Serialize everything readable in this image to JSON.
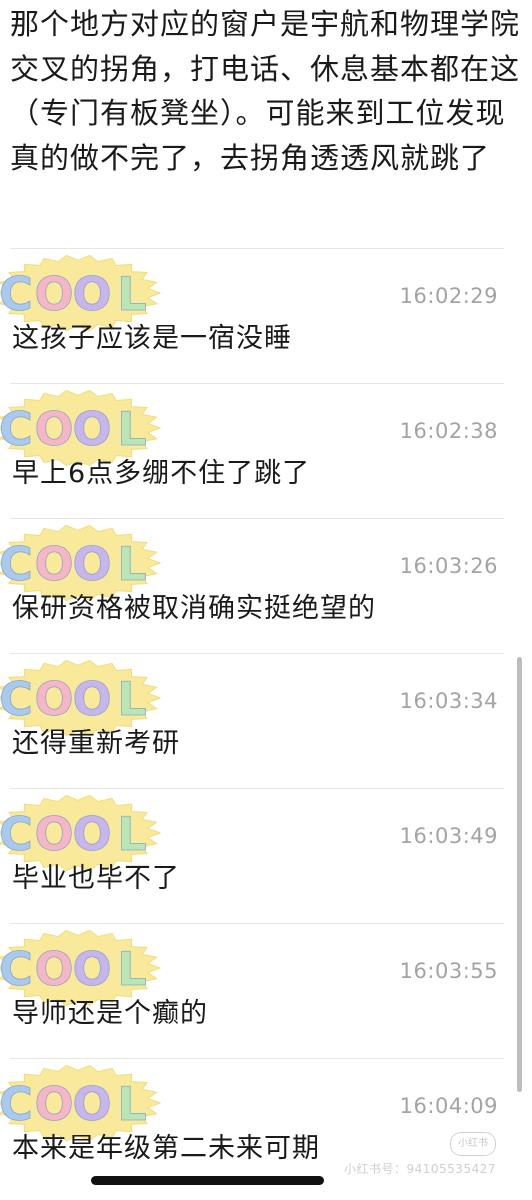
{
  "intro_text": "那个地方对应的窗户是宇航和物理学院交叉的拐角，打电话、休息基本都在这（专门有板凳坐）。可能来到工位发现真的做不完了，去拐角透透风就跳了",
  "avatar": {
    "label": "COOL",
    "blob_color": "#f8ea9a",
    "letter_colors": [
      "#a9c9f0",
      "#f6b6c8",
      "#c9b5ee",
      "#b9e6b4"
    ]
  },
  "messages": [
    {
      "time": "16:02:29",
      "text": "这孩子应该是一宿没睡"
    },
    {
      "time": "16:02:38",
      "text": "早上6点多绷不住了跳了"
    },
    {
      "time": "16:03:26",
      "text": "保研资格被取消确实挺绝望的"
    },
    {
      "time": "16:03:34",
      "text": "还得重新考研"
    },
    {
      "time": "16:03:49",
      "text": "毕业也毕不了"
    },
    {
      "time": "16:03:55",
      "text": "导师还是个癫的"
    },
    {
      "time": "16:04:09",
      "text": "本来是年级第二未来可期"
    }
  ],
  "watermark": {
    "logo": "小红书",
    "text": "小红书号：94105535427"
  }
}
